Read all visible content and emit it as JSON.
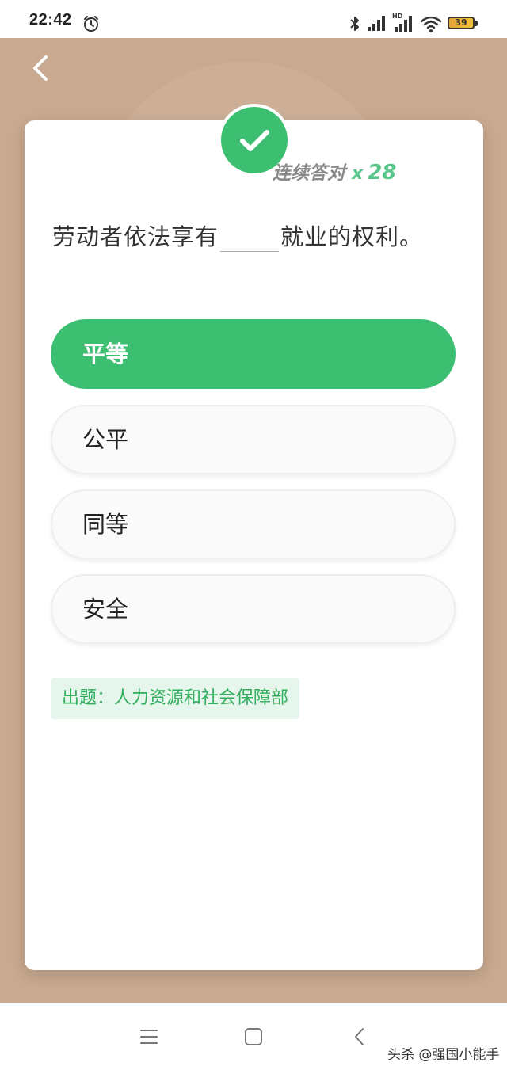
{
  "status_bar": {
    "time": "22:42",
    "battery_level": "39",
    "icons": [
      "alarm-icon",
      "bluetooth-icon",
      "signal-icon",
      "hd-signal-icon",
      "wifi-icon",
      "battery-icon"
    ]
  },
  "header": {
    "back_icon": "chevron-left-icon"
  },
  "result": {
    "status_icon": "check-icon",
    "status_color": "#3dbf72",
    "streak_label": "连续答对",
    "streak_multiplier": "x",
    "streak_count": "28"
  },
  "question": {
    "text_before": "劳动者依法享有",
    "text_after": "就业的权利。"
  },
  "options": [
    {
      "label": "平等",
      "selected": true
    },
    {
      "label": "公平",
      "selected": false
    },
    {
      "label": "同等",
      "selected": false
    },
    {
      "label": "安全",
      "selected": false
    }
  ],
  "source": {
    "text": "出题：人力资源和社会保障部"
  },
  "nav_bar": {
    "buttons": [
      "menu-icon",
      "home-icon",
      "back-icon"
    ]
  },
  "watermark": {
    "text": "头杀 @强国小能手"
  },
  "colors": {
    "accent": "#3dbf72",
    "background": "#c9a98f",
    "source_text": "#2fae5c",
    "source_bg": "#e7f6ec"
  }
}
